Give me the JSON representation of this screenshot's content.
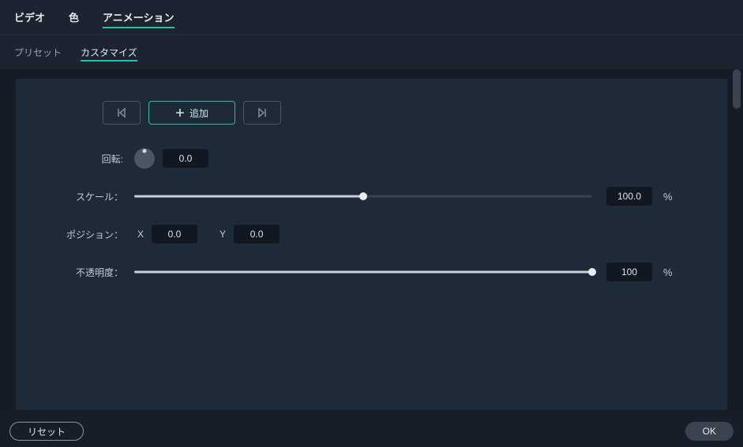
{
  "tabs": {
    "top": [
      {
        "label": "ビデオ",
        "active": false
      },
      {
        "label": "色",
        "active": false
      },
      {
        "label": "アニメーション",
        "active": true
      }
    ],
    "sub": [
      {
        "label": "プリセット",
        "active": false
      },
      {
        "label": "カスタマイズ",
        "active": true
      }
    ]
  },
  "kf": {
    "add_label": "追加"
  },
  "rotation": {
    "label": "回転:",
    "value": "0.0"
  },
  "scale": {
    "label": "スケール：",
    "value": "100.0",
    "percent": 50,
    "unit": "%"
  },
  "position": {
    "label": "ポジション：",
    "x_label": "X",
    "x_value": "0.0",
    "y_label": "Y",
    "y_value": "0.0"
  },
  "opacity": {
    "label": "不透明度：",
    "value": "100",
    "percent": 100,
    "unit": "%"
  },
  "footer": {
    "reset": "リセット",
    "ok": "OK"
  }
}
